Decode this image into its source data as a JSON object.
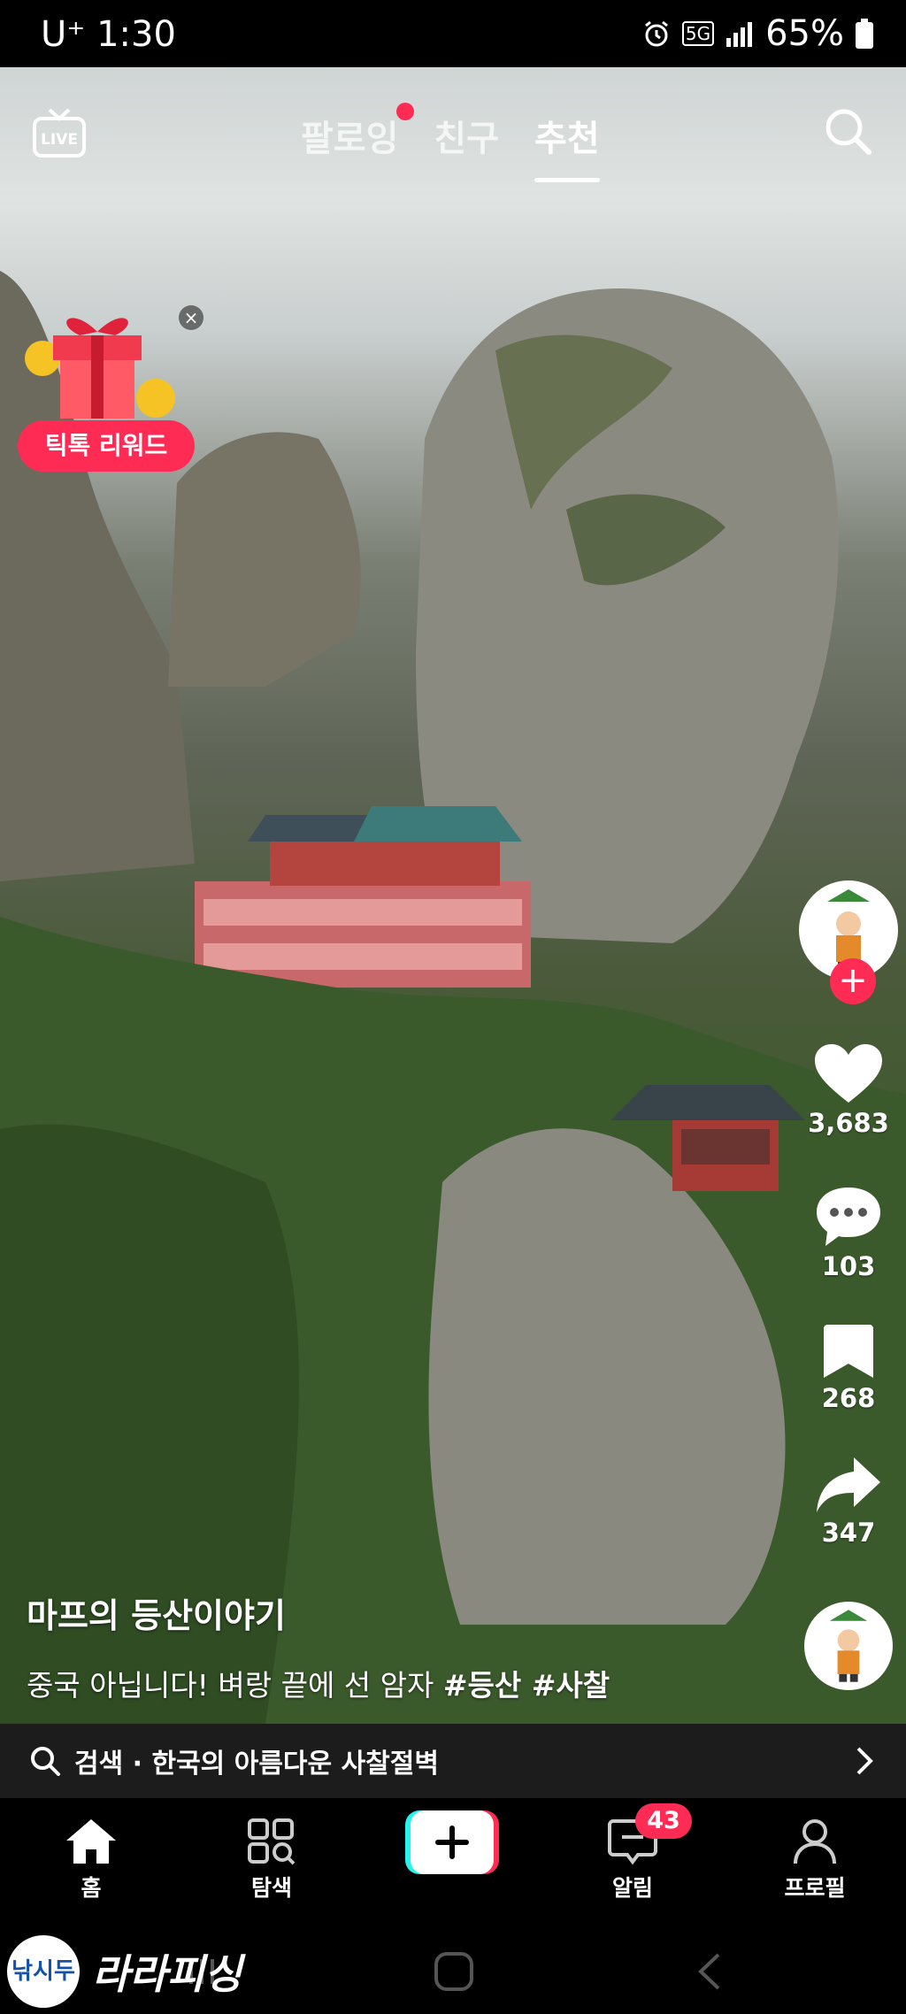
{
  "status_bar": {
    "carrier": "U⁺",
    "time": "1:30",
    "network": "5G",
    "battery": "65%"
  },
  "top_nav": {
    "live_label": "LIVE",
    "tabs": [
      {
        "label": "팔로잉"
      },
      {
        "label": "친구"
      },
      {
        "label": "추천"
      }
    ]
  },
  "reward": {
    "label": "틱톡 리워드"
  },
  "actions": {
    "likes": "3,683",
    "comments": "103",
    "saves": "268",
    "shares": "347"
  },
  "caption": {
    "author": "마프의 등산이야기",
    "text": "중국 아닙니다! 벼랑 끝에 선 암자",
    "tags": "#등산 #사찰"
  },
  "search_suggestion": {
    "text": "검색 · 한국의 아름다운 사찰절벽"
  },
  "bottom_nav": {
    "home": "홈",
    "explore": "탐색",
    "inbox": "알림",
    "inbox_badge": "43",
    "profile": "프로필"
  },
  "watermark": {
    "logo_text": "낚시두",
    "brand_text": "라라피싱"
  },
  "colors": {
    "accent": "#fe2c55",
    "cyan": "#25f4ee"
  }
}
